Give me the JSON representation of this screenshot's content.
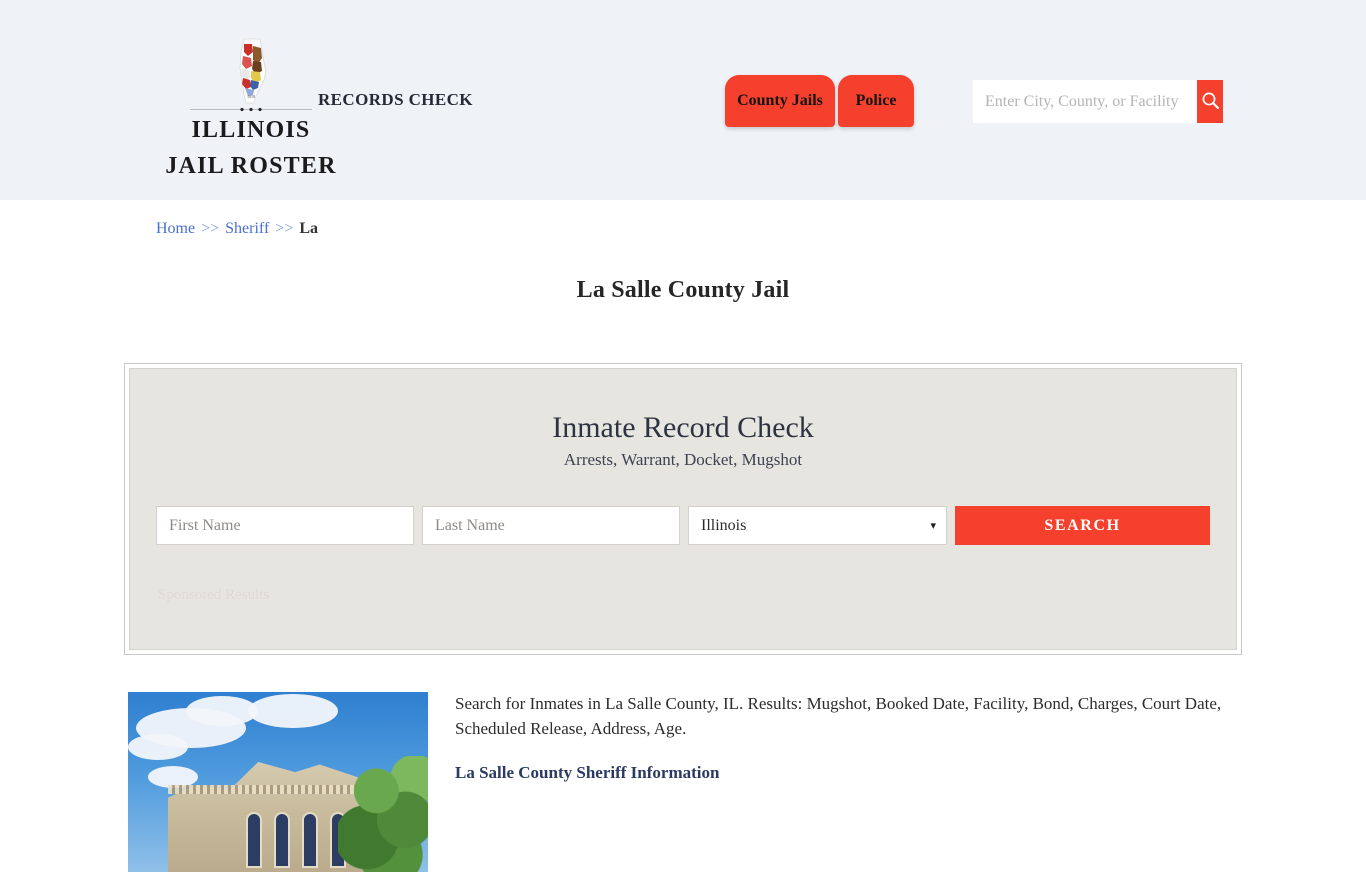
{
  "header": {
    "brand": {
      "emblem_icon": "illinois-state-flag-icon",
      "line1": "ILLINOIS",
      "line2": "JAIL ROSTER"
    },
    "tagline": "RECORDS CHECK",
    "nav": [
      {
        "label": "County Jails",
        "name": "county-jails"
      },
      {
        "label": "Police",
        "name": "police"
      }
    ],
    "search": {
      "placeholder": "Enter City, County, or Facility",
      "value": "",
      "button_icon": "search-icon"
    },
    "background_color": "#eff3f8",
    "accent_color": "#f4402c"
  },
  "breadcrumb": {
    "items": [
      {
        "label": "Home",
        "link": true
      },
      {
        "label": "Sheriff",
        "link": true
      },
      {
        "label": "La",
        "link": false
      }
    ],
    "separator": ">>"
  },
  "page": {
    "title": "La Salle County Jail"
  },
  "sponsor": {
    "title": "Inmate Record Check",
    "subtitle": "Arrests, Warrant, Docket, Mugshot",
    "form": {
      "first_name_placeholder": "First Name",
      "first_name_value": "",
      "last_name_placeholder": "Last Name",
      "last_name_value": "",
      "state_selected": "Illinois",
      "state_options": [
        "Illinois"
      ],
      "caret_icon": "chevron-down-icon",
      "search_label": "SEARCH"
    },
    "sponsored_label": "Sponsored Results"
  },
  "bottom": {
    "image_alt": "la-salle-county-courthouse-photo",
    "description": "Search for Inmates in La Salle County, IL. Results: Mugshot, Booked Date, Facility, Bond, Charges, Court Date, Scheduled Release, Address, Age.",
    "subheading": "La Salle County Sheriff Information"
  }
}
